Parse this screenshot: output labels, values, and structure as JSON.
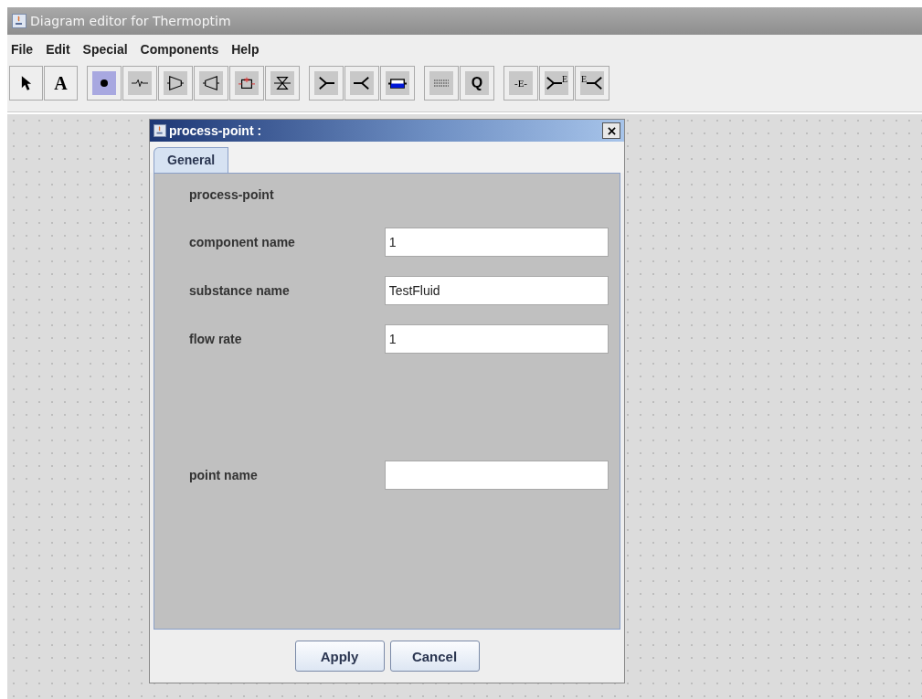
{
  "window": {
    "title": "Diagram editor for Thermoptim"
  },
  "menu": [
    "File",
    "Edit",
    "Special",
    "Components",
    "Help"
  ],
  "toolbar": [
    [
      {
        "kind": "pointer",
        "selected": false
      },
      {
        "kind": "text",
        "label": "A",
        "selected": false
      }
    ],
    [
      {
        "kind": "point",
        "selected": true
      },
      {
        "kind": "resistor",
        "selected": false
      },
      {
        "kind": "compressor",
        "selected": false
      },
      {
        "kind": "turbine",
        "selected": false
      },
      {
        "kind": "combustion",
        "selected": false
      },
      {
        "kind": "valve",
        "selected": false
      }
    ],
    [
      {
        "kind": "mixer",
        "selected": false
      },
      {
        "kind": "divider",
        "selected": false
      },
      {
        "kind": "exchanger",
        "selected": false
      }
    ],
    [
      {
        "kind": "list",
        "selected": false
      },
      {
        "kind": "text",
        "label": "Q",
        "selected": false
      }
    ],
    [
      {
        "kind": "text",
        "label": "-E-",
        "selected": false
      },
      {
        "kind": "mixer",
        "label": "E",
        "selected": false
      },
      {
        "kind": "divider",
        "label": "E",
        "selected": false
      }
    ]
  ],
  "dialog": {
    "title": "process-point :",
    "tabs": [
      {
        "label": "General",
        "selected": true
      }
    ],
    "rows": [
      {
        "kind": "heading",
        "label": "process-point"
      },
      {
        "kind": "field",
        "label": "component name",
        "value": "1"
      },
      {
        "kind": "field",
        "label": "substance name",
        "value": "TestFluid"
      },
      {
        "kind": "field",
        "label": "flow rate",
        "value": "1"
      },
      {
        "kind": "spacer"
      },
      {
        "kind": "field",
        "label": "point name"
      }
    ],
    "buttons": [
      "Apply",
      "Cancel"
    ]
  }
}
